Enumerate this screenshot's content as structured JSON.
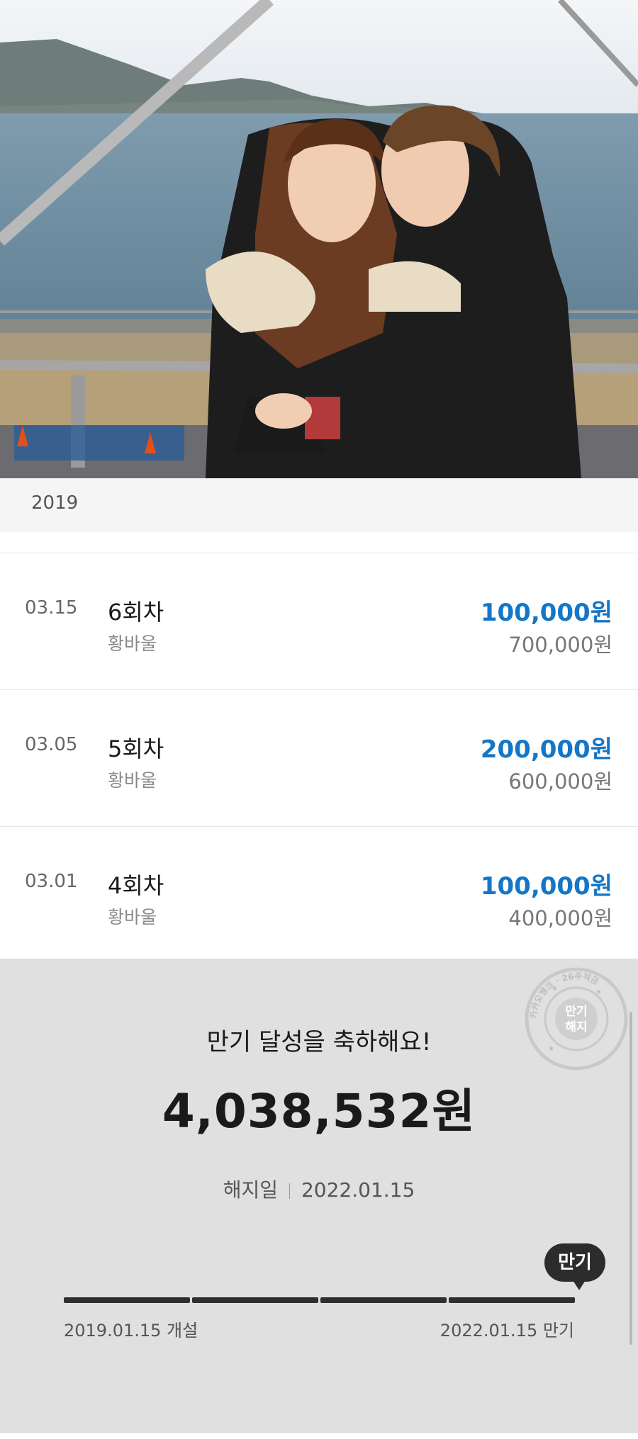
{
  "year_header": "2019",
  "transactions": [
    {
      "date": "03.15",
      "title": "6회차",
      "subtitle": "황바울",
      "amount": "100,000원",
      "total": "700,000원"
    },
    {
      "date": "03.05",
      "title": "5회차",
      "subtitle": "황바울",
      "amount": "200,000원",
      "total": "600,000원"
    },
    {
      "date": "03.01",
      "title": "4회차",
      "subtitle": "황바울",
      "amount": "100,000원",
      "total": "400,000원"
    }
  ],
  "summary": {
    "message": "만기 달성을 축하해요!",
    "amount": "4,038,532원",
    "closing_label": "해지일",
    "closing_date": "2022.01.15",
    "start_label": "2019.01.15 개설",
    "end_label": "2022.01.15 만기",
    "maturity_badge": "만기",
    "progress_fraction": 1.0,
    "stamp_center_text": "만기해지",
    "stamp_ring_text": "카카오뱅크 · 26주적금"
  },
  "colors": {
    "accent_blue": "#1476c6",
    "summary_bg": "#e0e0e0",
    "progress_fill": "#2f2f2f"
  }
}
